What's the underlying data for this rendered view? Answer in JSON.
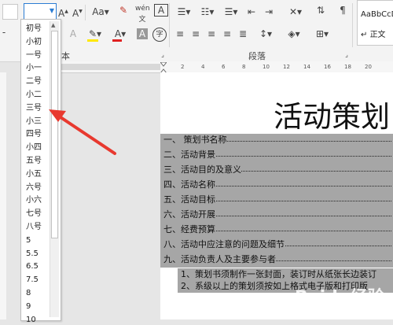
{
  "ribbon": {
    "font_group_section_label": "本",
    "paragraph_group_label": "段落",
    "style_preview": "AaBbCcDd",
    "style_name": "正文"
  },
  "font_size_dropdown": {
    "items": [
      "初号",
      "小初",
      "一号",
      "小一",
      "二号",
      "小二",
      "三号",
      "小三",
      "四号",
      "小四",
      "五号",
      "小五",
      "六号",
      "小六",
      "七号",
      "八号",
      "5",
      "5.5",
      "6.5",
      "7.5",
      "8",
      "9",
      "10"
    ]
  },
  "ruler": {
    "ticks": [
      "8",
      "6",
      "4",
      "2",
      "2",
      "4",
      "6",
      "8",
      "10",
      "12",
      "14",
      "16",
      "18",
      "20"
    ]
  },
  "document": {
    "title": "活动策划",
    "toc": [
      "一、 策划书名称",
      "二、活动背景",
      "三、活动目的及意义",
      "四、活动名称",
      "五、活动目标",
      "六、活动开展",
      "七、经费预算",
      "八、活动中应注意的问题及细节",
      "九、活动负责人及主要参与者"
    ],
    "notes": [
      "1、策划书须制作一张封面，装订时从纸张长边装订",
      "2、系级以上的策划须按如上格式电子版和打印版"
    ]
  },
  "watermark": "Baidu经验",
  "colors": {
    "highlight_gray": "#a6a6a6",
    "arrow_red": "#e8392f",
    "accent_blue": "#2b7cd3"
  }
}
